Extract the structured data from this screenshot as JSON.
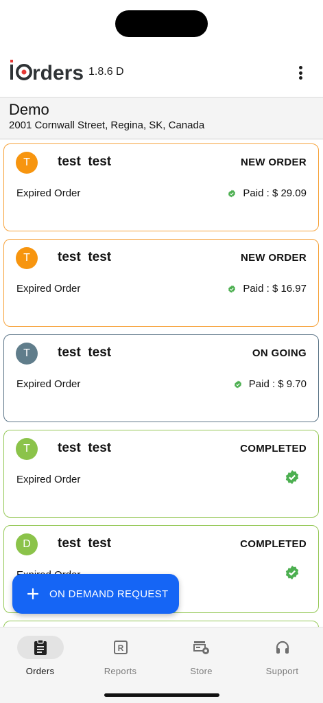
{
  "app": {
    "logo_text": "iOrders",
    "version": "1.8.6 D"
  },
  "store": {
    "name": "Demo",
    "address": "2001 Cornwall Street, Regina, SK, Canada"
  },
  "orders": [
    {
      "initial": "T",
      "customer": "test  test",
      "status": "NEW ORDER",
      "note": "Expired Order",
      "paid": "Paid : $ 29.09",
      "avatar_color": "#f7950f",
      "variant": "new"
    },
    {
      "initial": "T",
      "customer": "test  test",
      "status": "NEW ORDER",
      "note": "Expired Order",
      "paid": "Paid : $ 16.97",
      "avatar_color": "#f7950f",
      "variant": "new"
    },
    {
      "initial": "T",
      "customer": "test  test",
      "status": "ON GOING",
      "note": "Expired Order",
      "paid": "Paid : $ 9.70",
      "avatar_color": "#607d8b",
      "variant": "ongoing"
    },
    {
      "initial": "T",
      "customer": "test  test",
      "status": "COMPLETED",
      "note": "Expired Order",
      "paid": "",
      "avatar_color": "#8bc34a",
      "variant": "completed"
    },
    {
      "initial": "D",
      "customer": "test  test",
      "status": "COMPLETED",
      "note": "Expired Order",
      "paid": "",
      "avatar_color": "#8bc34a",
      "variant": "completed"
    }
  ],
  "fab": {
    "label": "ON DEMAND REQUEST",
    "color": "#1565f5"
  },
  "nav": [
    {
      "label": "Orders",
      "icon": "clipboard-icon",
      "active": true
    },
    {
      "label": "Reports",
      "icon": "reports-icon",
      "active": false
    },
    {
      "label": "Store",
      "icon": "store-settings-icon",
      "active": false
    },
    {
      "label": "Support",
      "icon": "headset-icon",
      "active": false
    }
  ],
  "colors": {
    "new_order_border": "#f6a23a",
    "ongoing_border": "#5c7588",
    "completed_border": "#95c857",
    "check_green": "#4caf50"
  }
}
